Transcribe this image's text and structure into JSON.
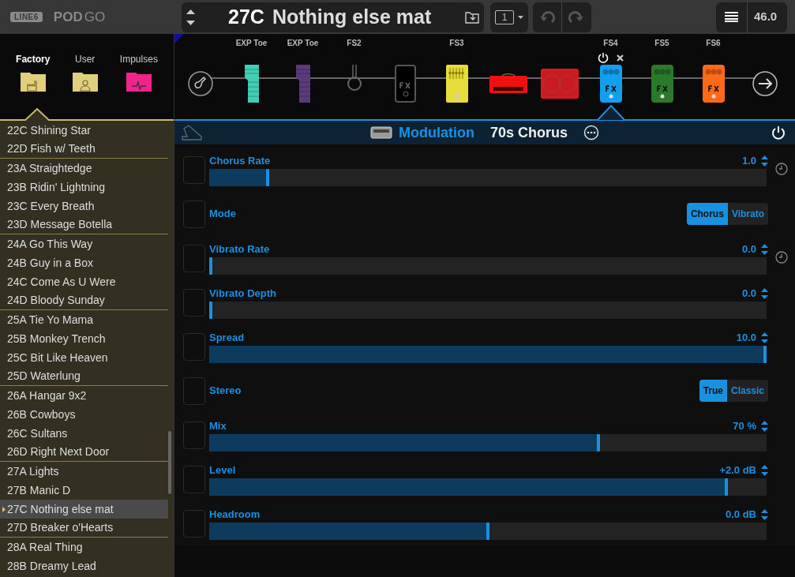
{
  "logo": {
    "brand": "LINE6",
    "product": "POD",
    "model": "GO"
  },
  "preset": {
    "number": "27C",
    "name": "Nothing else mat"
  },
  "snapshot": "1",
  "tempo": "46.0",
  "library_tabs": [
    {
      "label": "Factory",
      "selected": true,
      "kind": "factory",
      "color": "#e2cf7c"
    },
    {
      "label": "User",
      "selected": false,
      "kind": "user",
      "color": "#e2cf7c"
    },
    {
      "label": "Impulses",
      "selected": false,
      "kind": "impulse",
      "color": "#f0238f"
    }
  ],
  "presets": [
    {
      "label": "22C Shining Star",
      "selected": false
    },
    {
      "label": "22D Fish w/ Teeth",
      "selected": false
    },
    {
      "label": "23A Straightedge",
      "selected": false
    },
    {
      "label": "23B Ridin' Lightning",
      "selected": false
    },
    {
      "label": "23C Every Breath",
      "selected": false
    },
    {
      "label": "23D Message Botella",
      "selected": false
    },
    {
      "label": "24A Go This Way",
      "selected": false
    },
    {
      "label": "24B Guy in a Box",
      "selected": false
    },
    {
      "label": "24C Come As U Were",
      "selected": false
    },
    {
      "label": "24D Bloody Sunday",
      "selected": false
    },
    {
      "label": "25A Tie Yo Mama",
      "selected": false
    },
    {
      "label": "25B Monkey Trench",
      "selected": false
    },
    {
      "label": "25C Bit Like Heaven",
      "selected": false
    },
    {
      "label": "25D Waterlung",
      "selected": false
    },
    {
      "label": "26A Hangar 9x2",
      "selected": false
    },
    {
      "label": "26B Cowboys",
      "selected": false
    },
    {
      "label": "26C Sultans",
      "selected": false
    },
    {
      "label": "26D Right Next Door",
      "selected": false
    },
    {
      "label": "27A Lights",
      "selected": false
    },
    {
      "label": "27B Manic D",
      "selected": false
    },
    {
      "label": "27C Nothing else mat",
      "selected": true
    },
    {
      "label": "27D Breaker o'Hearts",
      "selected": false
    },
    {
      "label": "28A Real Thing",
      "selected": false
    },
    {
      "label": "28B Dreamy Lead",
      "selected": false
    }
  ],
  "chain": [
    {
      "kind": "input",
      "selected": false
    },
    {
      "kind": "expression",
      "label": "EXP Toe",
      "color": "#3ecfb4",
      "selected": false
    },
    {
      "kind": "expression",
      "label": "EXP Toe",
      "color": "#5a3a78",
      "selected": false
    },
    {
      "kind": "empty",
      "label": "FS2",
      "selected": false
    },
    {
      "kind": "empty-fx",
      "selected": false
    },
    {
      "kind": "eq",
      "label": "FS3",
      "color": "#e6dc3a",
      "selected": false
    },
    {
      "kind": "amp",
      "color": "#ee1111",
      "selected": false
    },
    {
      "kind": "cab",
      "color": "#c81c22",
      "selected": false
    },
    {
      "kind": "fx",
      "label": "FS4",
      "color": "#129ff0",
      "selected": true
    },
    {
      "kind": "fx",
      "label": "FS5",
      "color": "#2a7a2a",
      "selected": false
    },
    {
      "kind": "fx",
      "label": "FS6",
      "color": "#ff6a1a",
      "selected": false
    },
    {
      "kind": "output",
      "selected": false
    }
  ],
  "block": {
    "category": "Modulation",
    "model": "70s Chorus",
    "on": true
  },
  "params": [
    {
      "kind": "slider",
      "label": "Chorus Rate",
      "value": "1.0",
      "level": 0.103,
      "tempo_sync": true
    },
    {
      "kind": "toggle",
      "label": "Mode",
      "options": [
        {
          "label": "Chorus",
          "selected": true
        },
        {
          "label": "Vibrato",
          "selected": false
        }
      ]
    },
    {
      "kind": "slider",
      "label": "Vibrato Rate",
      "value": "0.0",
      "level": 0,
      "tempo_sync": true
    },
    {
      "kind": "slider",
      "label": "Vibrato Depth",
      "value": "0.0",
      "level": 0,
      "tempo_sync": false
    },
    {
      "kind": "slider",
      "label": "Spread",
      "value": "10.0",
      "level": 1,
      "tempo_sync": false
    },
    {
      "kind": "toggle",
      "label": "Stereo",
      "options": [
        {
          "label": "True",
          "selected": true
        },
        {
          "label": "Classic",
          "selected": false
        }
      ]
    },
    {
      "kind": "slider",
      "label": "Mix",
      "value": "70 %",
      "level": 0.7,
      "tempo_sync": false
    },
    {
      "kind": "slider",
      "label": "Level",
      "value": "+2.0 dB",
      "level": 0.93,
      "tempo_sync": false
    },
    {
      "kind": "slider",
      "label": "Headroom",
      "value": "0.0 dB",
      "level": 0.5,
      "tempo_sync": false
    }
  ]
}
